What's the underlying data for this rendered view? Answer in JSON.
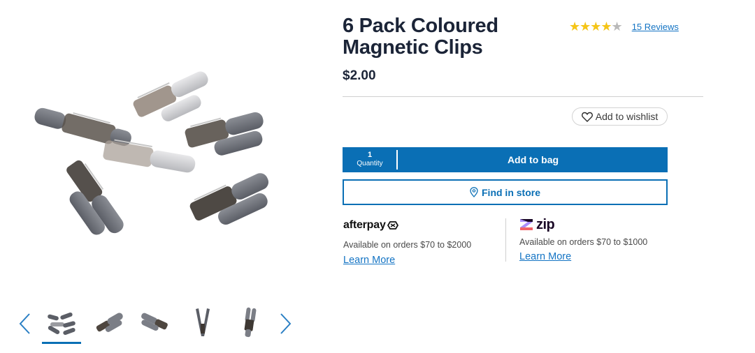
{
  "product": {
    "title": "6 Pack Coloured Magnetic Clips",
    "price": "$2.00",
    "rating_stars": "★★★★",
    "rating_half": "★",
    "rating_value": 4.5,
    "reviews_link": "15 Reviews"
  },
  "actions": {
    "wishlist_label": "Add to wishlist",
    "quantity_value": "1",
    "quantity_label": "Quantity",
    "add_to_bag_label": "Add to bag",
    "find_in_store_label": "Find in store"
  },
  "payments": {
    "afterpay": {
      "logo_text": "afterpay",
      "description": "Available on orders $70 to $2000",
      "link": "Learn More"
    },
    "zip": {
      "logo_text": "zip",
      "description": "Available on orders $70 to $1000",
      "link": "Learn More"
    }
  },
  "gallery": {
    "thumbnail_count": 5,
    "selected_index": 0,
    "icons": [
      "chevron-left-icon",
      "chevron-right-icon",
      "heart-icon",
      "location-pin-icon"
    ]
  },
  "colors": {
    "brand_blue": "#0a6fb5",
    "star": "#f5c518",
    "link": "#1474c4",
    "title": "#1b2437"
  }
}
